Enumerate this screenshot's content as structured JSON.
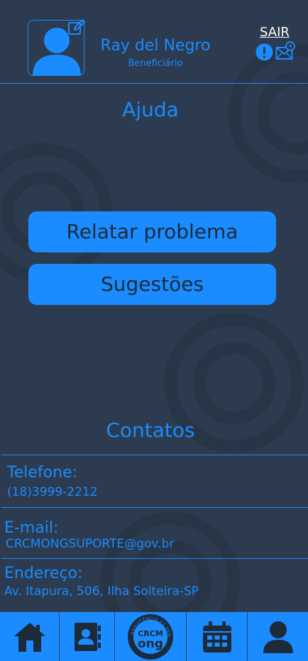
{
  "header": {
    "user_name": "Ray del Negro",
    "user_role": "Beneficiário",
    "logout_label": "SAIR"
  },
  "help": {
    "title": "Ajuda",
    "buttons": {
      "report": "Relatar problema",
      "suggestions": "Sugestões"
    }
  },
  "contacts": {
    "title": "Contatos",
    "phone_label": "Telefone:",
    "phone_value": "(18)3999-2212",
    "email_label": "E-mail:",
    "email_value": "CRCMONGSUPORTE@gov.br",
    "address_label": "Endereço:",
    "address_value": "Av. Itapura, 506, Ilha Solteira-SP"
  },
  "nav": {
    "logo_text_top": "CRCM",
    "logo_text_bottom": "ong",
    "logo_ring_text": "ASSISTÊNCIA ÀS FAMÍLIAS",
    "icons": [
      "home-icon",
      "contacts-book-icon",
      "crcm-ong-logo",
      "calendar-icon",
      "user-icon"
    ]
  },
  "colors": {
    "accent": "#1a8cff",
    "background": "#2c3b4f",
    "nav_icon": "#1d2a3a",
    "alert_badge": "#1a8cff"
  }
}
